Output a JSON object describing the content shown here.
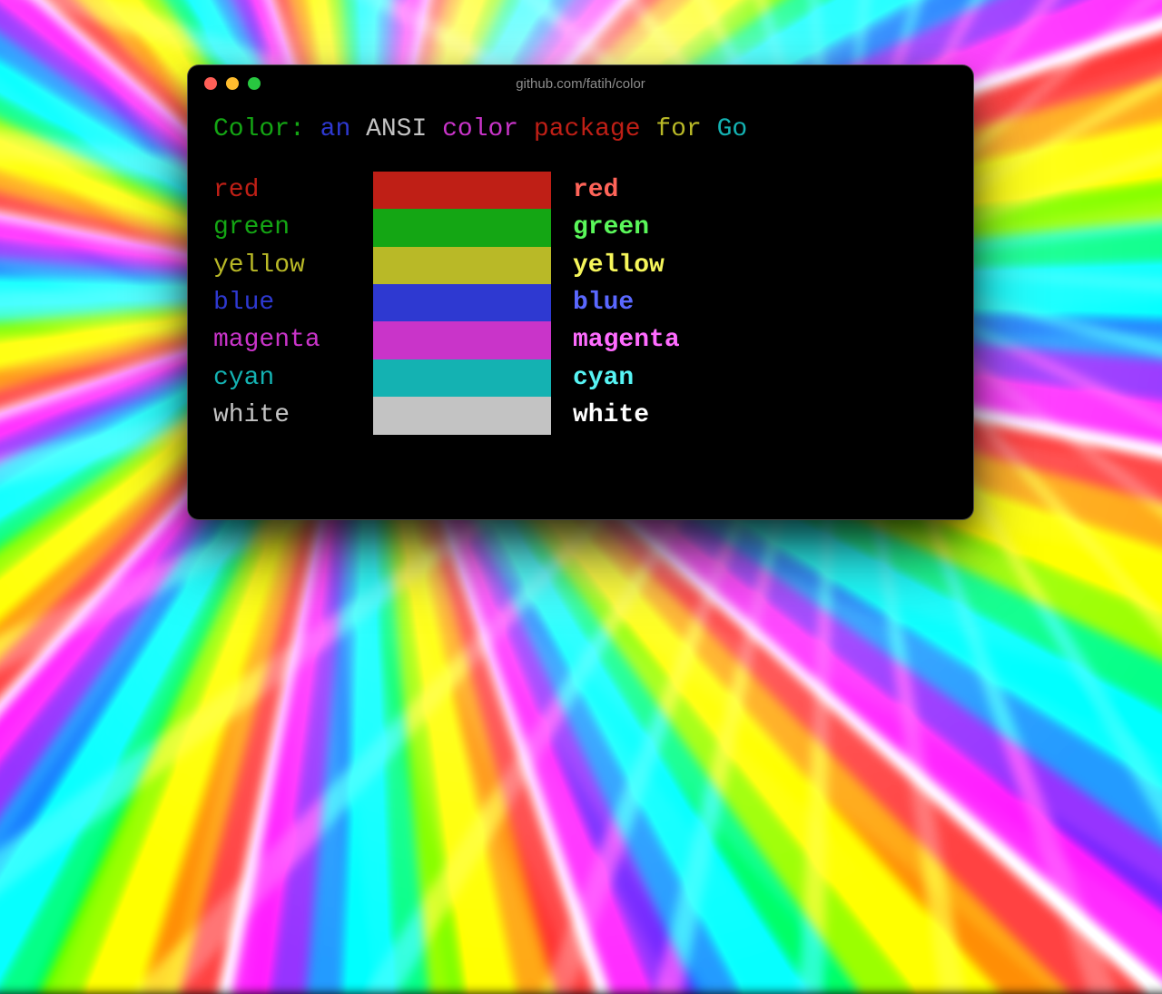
{
  "window": {
    "title": "github.com/fatih/color"
  },
  "headline": {
    "prefix": {
      "text": "Color:",
      "color": "#14a614"
    },
    "words": [
      {
        "text": "an",
        "color": "#2e39d1"
      },
      {
        "text": "ANSI",
        "color": "#c3c3c3"
      },
      {
        "text": "color",
        "color": "#c934c9"
      },
      {
        "text": "package",
        "color": "#bf1f16"
      },
      {
        "text": "for",
        "color": "#b9b927"
      },
      {
        "text": "Go",
        "color": "#14b2b2"
      }
    ]
  },
  "rows": [
    {
      "name": "red",
      "normal": "#bf1f16",
      "swatch": "#bf1f16",
      "bold": "#ff6459"
    },
    {
      "name": "green",
      "normal": "#14a614",
      "swatch": "#14a614",
      "bold": "#5af75a"
    },
    {
      "name": "yellow",
      "normal": "#b9b927",
      "swatch": "#b9b927",
      "bold": "#f6f65b"
    },
    {
      "name": "blue",
      "normal": "#2e39d1",
      "swatch": "#2e39d1",
      "bold": "#5a68ff"
    },
    {
      "name": "magenta",
      "normal": "#c934c9",
      "swatch": "#c934c9",
      "bold": "#ff6cff"
    },
    {
      "name": "cyan",
      "normal": "#14b2b2",
      "swatch": "#14b2b2",
      "bold": "#57f4f4"
    },
    {
      "name": "white",
      "normal": "#c3c3c3",
      "swatch": "#c3c3c3",
      "bold": "#ffffff"
    }
  ]
}
